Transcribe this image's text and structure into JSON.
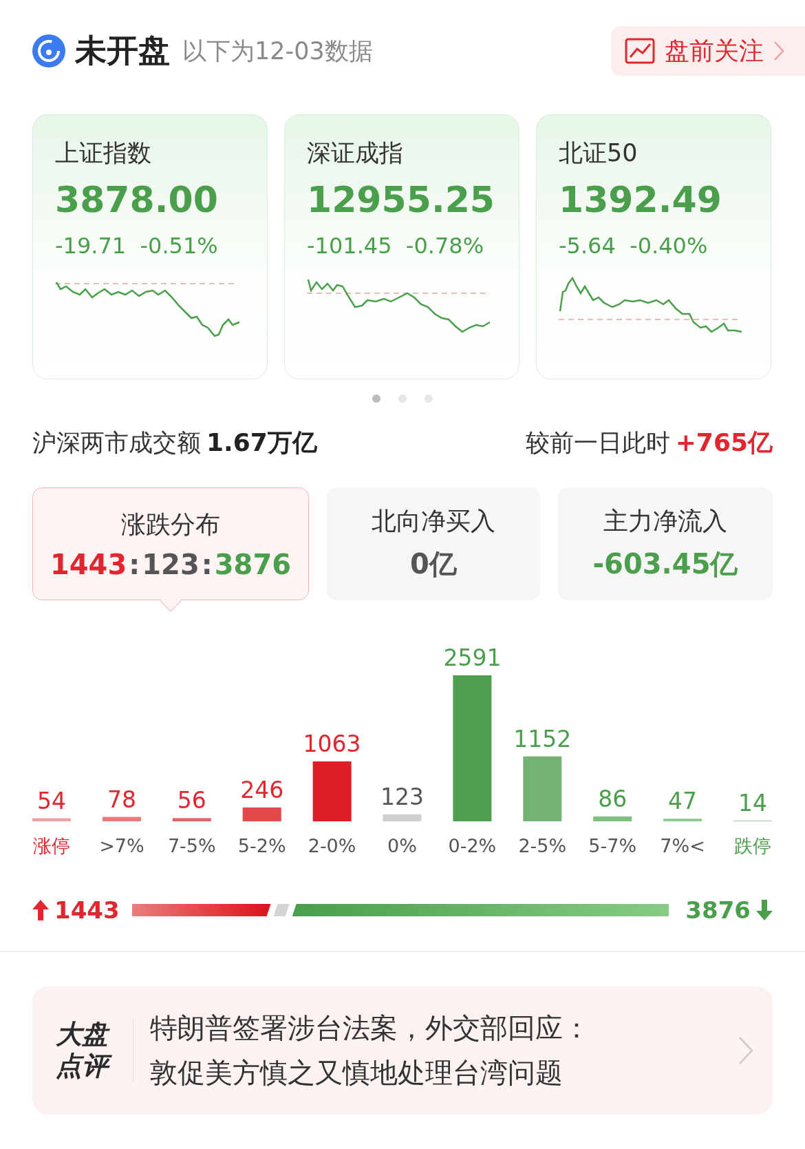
{
  "header": {
    "title": "未开盘",
    "subtitle": "以下为12-03数据",
    "action": {
      "label": "盘前关注"
    }
  },
  "indices": [
    {
      "name": "上证指数",
      "value": "3878.00",
      "change": "-19.71",
      "percent": "-0.51%"
    },
    {
      "name": "深证成指",
      "value": "12955.25",
      "change": "-101.45",
      "percent": "-0.78%"
    },
    {
      "name": "北证50",
      "value": "1392.49",
      "change": "-5.64",
      "percent": "-0.40%"
    }
  ],
  "pager": [
    {
      "selected": true
    },
    {
      "selected": false
    },
    {
      "selected": false
    }
  ],
  "turnover": {
    "label": "沪深两市成交额",
    "value": "1.67万亿",
    "compare_label": "较前一日此时",
    "compare_value": "+765亿"
  },
  "tiles": [
    {
      "label": "涨跌分布",
      "selected": true,
      "parts": [
        {
          "text": "1443",
          "color": "#e0262e"
        },
        {
          "text": ":",
          "color": "#555555"
        },
        {
          "text": "123",
          "color": "#555555"
        },
        {
          "text": ":",
          "color": "#555555"
        },
        {
          "text": "3876",
          "color": "#4a9e4c"
        }
      ]
    },
    {
      "label": "北向净买入",
      "selected": false,
      "parts": [
        {
          "text": "0亿",
          "color": "#555555"
        }
      ]
    },
    {
      "label": "主力净流入",
      "selected": false,
      "parts": [
        {
          "text": "-603.45亿",
          "color": "#4a9e4c"
        }
      ]
    }
  ],
  "distribution": {
    "chart_data": {
      "type": "bar",
      "categories": [
        "涨停",
        ">7%",
        "7-5%",
        "5-2%",
        "2-0%",
        "0%",
        "0-2%",
        "2-5%",
        "5-7%",
        "7%<",
        "跌停"
      ],
      "values": [
        54,
        78,
        56,
        246,
        1063,
        123,
        2591,
        1152,
        86,
        47,
        14
      ],
      "data_labels": true
    },
    "bars": [
      {
        "color": "#f0a0a0",
        "value": {
          "color": "#e0262e"
        },
        "label": {
          "color": "#e0262e"
        }
      },
      {
        "color": "#e87a7a",
        "value": {
          "color": "#e0262e"
        },
        "label": {
          "color": "#555555"
        }
      },
      {
        "color": "#e46464",
        "value": {
          "color": "#e0262e"
        },
        "label": {
          "color": "#555555"
        }
      },
      {
        "color": "#e04a4a",
        "value": {
          "color": "#e0262e"
        },
        "label": {
          "color": "#555555"
        }
      },
      {
        "color": "#dc1f26",
        "value": {
          "color": "#e0262e"
        },
        "label": {
          "color": "#555555"
        }
      },
      {
        "color": "#cfcfcf",
        "value": {
          "color": "#555555"
        },
        "label": {
          "color": "#555555"
        }
      },
      {
        "color": "#4e9e4e",
        "value": {
          "color": "#4a9e4c"
        },
        "label": {
          "color": "#555555"
        }
      },
      {
        "color": "#74b274",
        "value": {
          "color": "#4a9e4c"
        },
        "label": {
          "color": "#555555"
        }
      },
      {
        "color": "#7fbf7f",
        "value": {
          "color": "#4a9e4c"
        },
        "label": {
          "color": "#555555"
        }
      },
      {
        "color": "#8ecb8e",
        "value": {
          "color": "#4a9e4c"
        },
        "label": {
          "color": "#555555"
        }
      },
      {
        "color": "#9fd49f",
        "value": {
          "color": "#4a9e4c"
        },
        "label": {
          "color": "#4a9e4c"
        }
      }
    ]
  },
  "ratio": {
    "up_count": "1443",
    "down_count": "3876"
  },
  "news": {
    "brand": [
      "大盘",
      "点评"
    ],
    "lines": [
      "特朗普签署涉台法案，外交部回应：",
      "敦促美方慎之又慎地处理台湾问题"
    ]
  }
}
